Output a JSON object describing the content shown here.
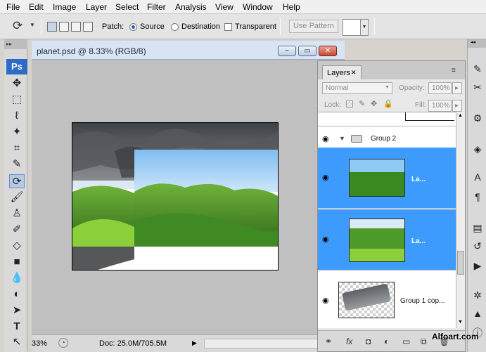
{
  "menu": [
    "File",
    "Edit",
    "Image",
    "Layer",
    "Select",
    "Filter",
    "Analysis",
    "View",
    "Window",
    "Help"
  ],
  "options": {
    "patch_label": "Patch:",
    "source_label": "Source",
    "destination_label": "Destination",
    "transparent_label": "Transparent",
    "use_pattern_label": "Use Pattern",
    "source_selected": true
  },
  "tools": {
    "logo": "Ps"
  },
  "document": {
    "title": "planet.psd @ 8.33% (RGB/8)",
    "min_btn": "−",
    "max_btn": "▭",
    "close_btn": "✕",
    "zoom": "33%",
    "doc_info": "Doc: 25.0M/705.5M"
  },
  "layers_panel": {
    "tab_label": "Layers",
    "blend_mode": "Normal",
    "opacity_label": "Opacity:",
    "opacity_value": "100%",
    "lock_label": "Lock:",
    "fill_label": "Fill:",
    "fill_value": "100%",
    "group_name": "Group 2",
    "layers": [
      {
        "name": "La...",
        "selected": true
      },
      {
        "name": "La...",
        "selected": true
      },
      {
        "name": "Group 1 cop...",
        "selected": false
      }
    ]
  },
  "watermark": "Alfoart.com",
  "colors": {
    "selection": "#3c9bfd",
    "sky": "#8fc9f5",
    "grass": "#4f9b2a",
    "storm": "#5d6064"
  }
}
